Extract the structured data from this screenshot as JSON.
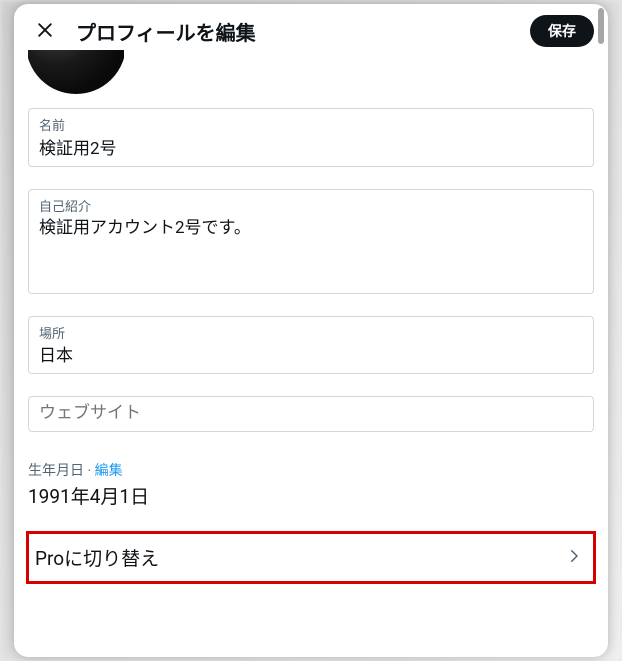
{
  "header": {
    "title": "プロフィールを編集",
    "save_label": "保存"
  },
  "fields": {
    "name": {
      "label": "名前",
      "value": "検証用2号"
    },
    "bio": {
      "label": "自己紹介",
      "value": "検証用アカウント2号です。"
    },
    "location": {
      "label": "場所",
      "value": "日本"
    },
    "website": {
      "placeholder": "ウェブサイト",
      "value": ""
    }
  },
  "dob": {
    "label": "生年月日",
    "edit_link": "編集",
    "value": "1991年4月1日"
  },
  "pro": {
    "label": "Proに切り替え"
  }
}
